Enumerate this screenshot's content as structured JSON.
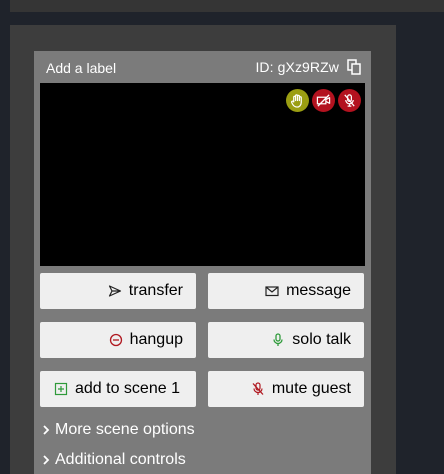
{
  "card": {
    "label": "Add a label",
    "id_text": "ID: gXz9RZw"
  },
  "badges": [
    {
      "icon": "raised-hand-icon",
      "color": "#9b9e12"
    },
    {
      "icon": "camera-off-icon",
      "color": "#b3121f"
    },
    {
      "icon": "mic-off-icon",
      "color": "#b3121f"
    }
  ],
  "buttons": {
    "transfer": "transfer",
    "message": "message",
    "hangup": "hangup",
    "solo_talk": "solo talk",
    "add_to_scene": "add to scene 1",
    "mute_guest": "mute guest"
  },
  "links": {
    "more_scene_options": "More scene options",
    "additional_controls": "Additional controls"
  }
}
